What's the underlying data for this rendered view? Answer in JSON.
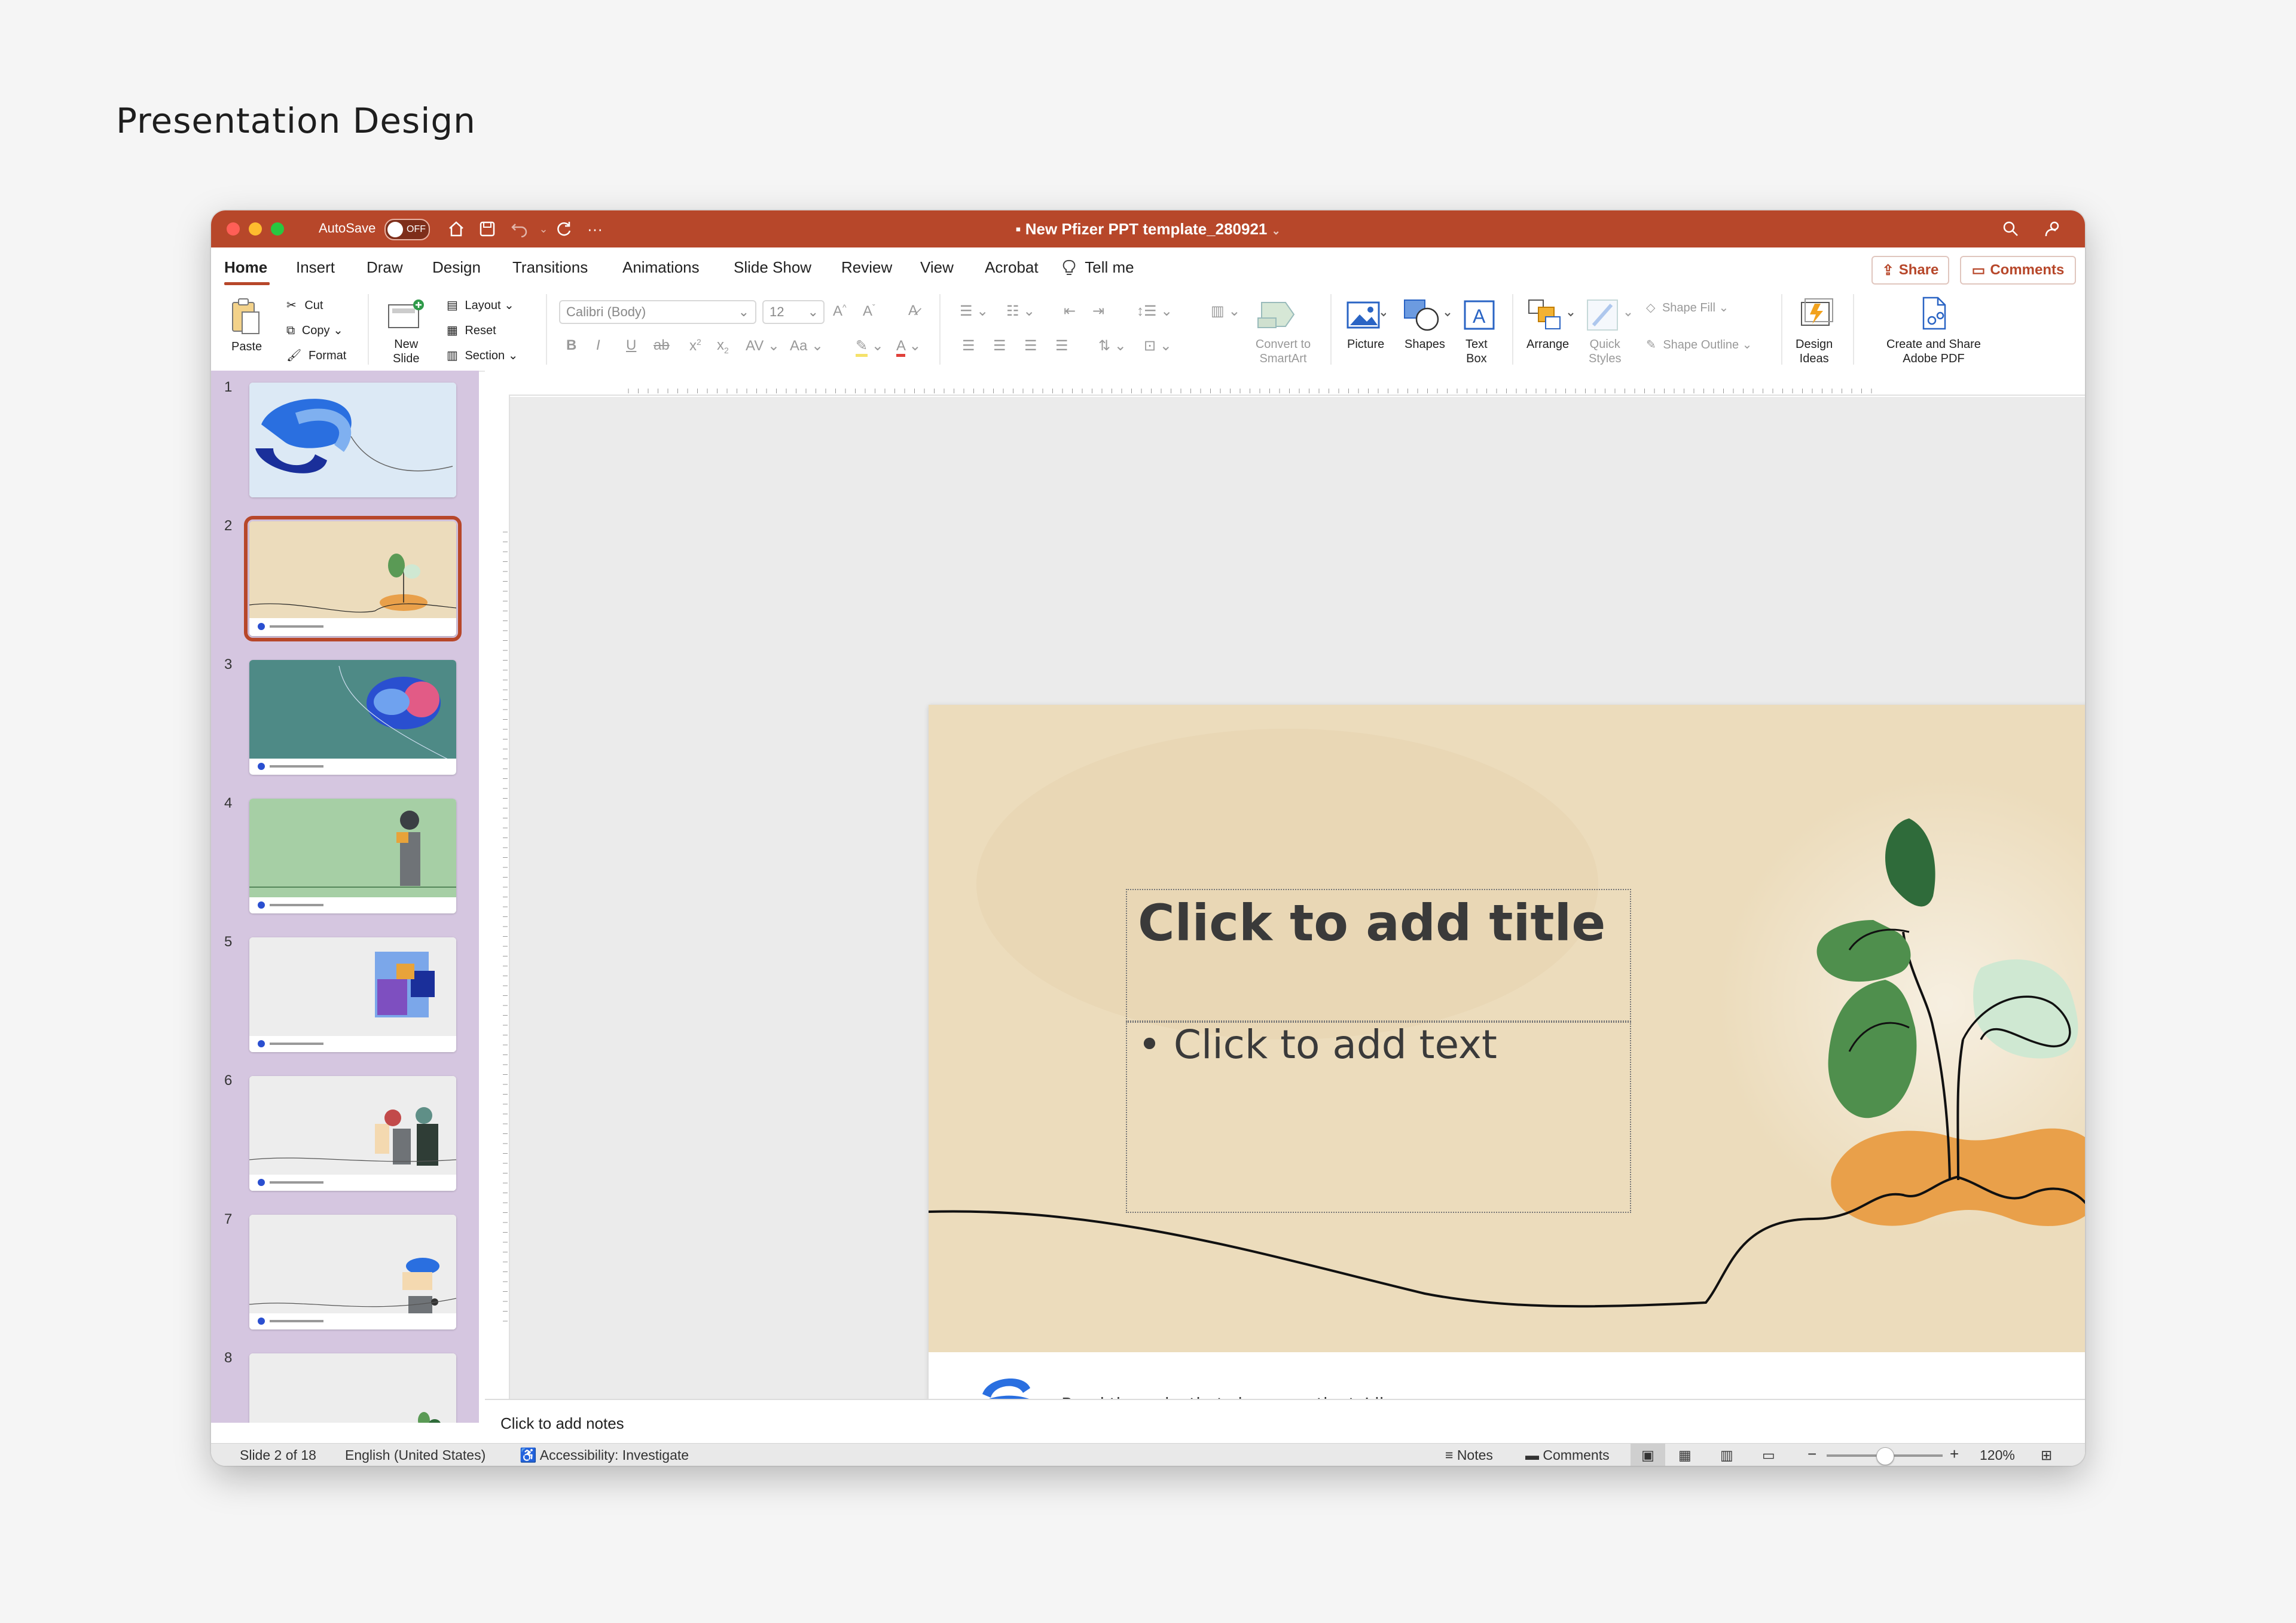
{
  "page": {
    "heading": "Presentation Design"
  },
  "window": {
    "autosave_label": "AutoSave",
    "autosave_state": "OFF",
    "document_title": "New Pfizer PPT template_280921",
    "accent_color": "#b7472a"
  },
  "menu": {
    "tabs": [
      "Home",
      "Insert",
      "Draw",
      "Design",
      "Transitions",
      "Animations",
      "Slide Show",
      "Review",
      "View",
      "Acrobat"
    ],
    "tell_me": "Tell me",
    "share": "Share",
    "comments": "Comments"
  },
  "ribbon": {
    "paste": "Paste",
    "cut": "Cut",
    "copy": "Copy",
    "format": "Format",
    "new_slide_1": "New",
    "new_slide_2": "Slide",
    "layout": "Layout",
    "reset": "Reset",
    "section": "Section",
    "font_name": "Calibri (Body)",
    "font_size": "12",
    "convert_1": "Convert to",
    "convert_2": "SmartArt",
    "picture": "Picture",
    "shapes": "Shapes",
    "textbox_1": "Text",
    "textbox_2": "Box",
    "arrange": "Arrange",
    "quick_1": "Quick",
    "quick_2": "Styles",
    "shape_fill": "Shape Fill",
    "shape_outline": "Shape Outline",
    "design_1": "Design",
    "design_2": "Ideas",
    "pdf_1": "Create and Share",
    "pdf_2": "Adobe PDF"
  },
  "thumbnails": [
    {
      "num": "1",
      "bg": "#dce9f5"
    },
    {
      "num": "2",
      "bg": "#ecdcbc"
    },
    {
      "num": "3",
      "bg": "#4e8a86"
    },
    {
      "num": "4",
      "bg": "#a6cfa5"
    },
    {
      "num": "5",
      "bg": "#ededed"
    },
    {
      "num": "6",
      "bg": "#ededed"
    },
    {
      "num": "7",
      "bg": "#ededed"
    },
    {
      "num": "8",
      "bg": "#ededed"
    }
  ],
  "slide": {
    "title_placeholder": "Click to add title",
    "body_placeholder": "• Click to add text",
    "footer_text": "Breakthroughs that change patients’ lives"
  },
  "notes": {
    "placeholder": "Click to add notes"
  },
  "status": {
    "slide_counter": "Slide 2 of 18",
    "language": "English (United States)",
    "accessibility": "Accessibility: Investigate",
    "notes": "Notes",
    "comments": "Comments",
    "zoom": "120%",
    "zoom_level": 0.5
  }
}
